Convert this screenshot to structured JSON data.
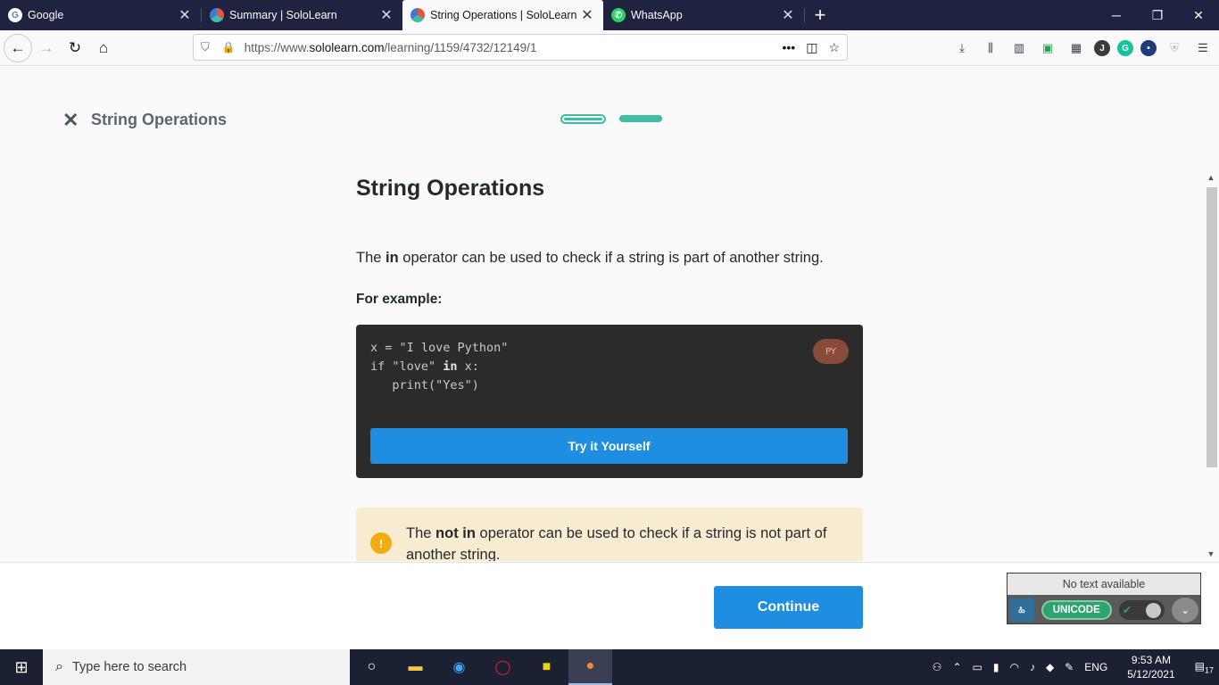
{
  "browser": {
    "tabs": [
      {
        "title": "Google",
        "favicon": "google-icon"
      },
      {
        "title": "Summary | SoloLearn",
        "favicon": "sololearn-icon"
      },
      {
        "title": "String Operations | SoloLearn",
        "favicon": "sololearn-icon",
        "active": true
      },
      {
        "title": "WhatsApp",
        "favicon": "whatsapp-icon"
      }
    ],
    "url_prefix": "https://www.",
    "url_domain": "sololearn.com",
    "url_path": "/learning/1159/4732/12149/1"
  },
  "lesson": {
    "header_title": "String Operations",
    "progress_segments": 2,
    "current_segment": 1,
    "title": "String Operations",
    "para_before": "The ",
    "para_bold": "in",
    "para_after": " operator can be used to check if a string is part of another string.",
    "example_label": "For example:",
    "code_line1": "x = \"I love Python\"",
    "code_line2_a": "if \"love\" ",
    "code_line2_kw": "in",
    "code_line2_b": " x:",
    "code_line3": "   print(\"Yes\")",
    "lang_badge": "PY",
    "try_button": "Try it Yourself",
    "note_before": "The ",
    "note_bold": "not in",
    "note_after": " operator can be used to check if a string is not part of another string.",
    "continue_button": "Continue"
  },
  "widget": {
    "status": "No text available",
    "mode": "UNICODE",
    "logo": "ಹಿ"
  },
  "taskbar": {
    "search_placeholder": "Type here to search",
    "language": "ENG",
    "time": "9:53 AM",
    "date": "5/12/2021",
    "notifications": "17"
  },
  "colors": {
    "accent": "#1f8ee0",
    "progress": "#3ebfa3",
    "note_bg": "#f8ecd0",
    "code_bg": "#2b2b2b"
  }
}
